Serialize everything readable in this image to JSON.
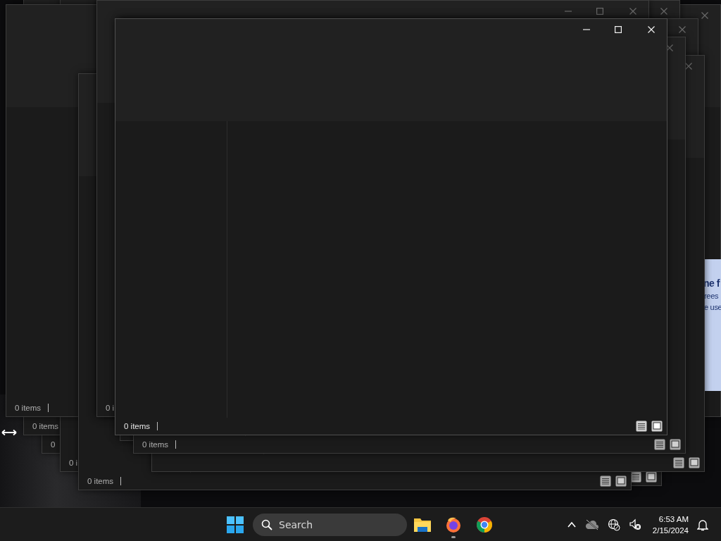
{
  "windows": [
    {
      "status": "0 items",
      "active": false
    },
    {
      "status": "0",
      "active": false
    },
    {
      "status": "0 i",
      "active": false
    },
    {
      "status": "0 items",
      "active": false
    },
    {
      "active": false
    },
    {
      "active": false
    },
    {
      "status": "0 items",
      "active": false
    },
    {
      "active": false
    },
    {
      "status": "0 i",
      "active": false
    },
    {
      "active": false
    },
    {
      "status": "0 items",
      "active": false
    },
    {
      "status": "0 items",
      "active": true
    }
  ],
  "side_panel": {
    "heading": "ne f",
    "lines": [
      "rees",
      "e use"
    ]
  },
  "taskbar": {
    "search": {
      "placeholder": "Search"
    },
    "apps": [
      {
        "kind": "files",
        "running": false
      },
      {
        "kind": "firefox",
        "running": true
      },
      {
        "kind": "chrome",
        "running": false
      }
    ],
    "clock": {
      "time": "6:53 AM",
      "date": "2/15/2024"
    }
  }
}
